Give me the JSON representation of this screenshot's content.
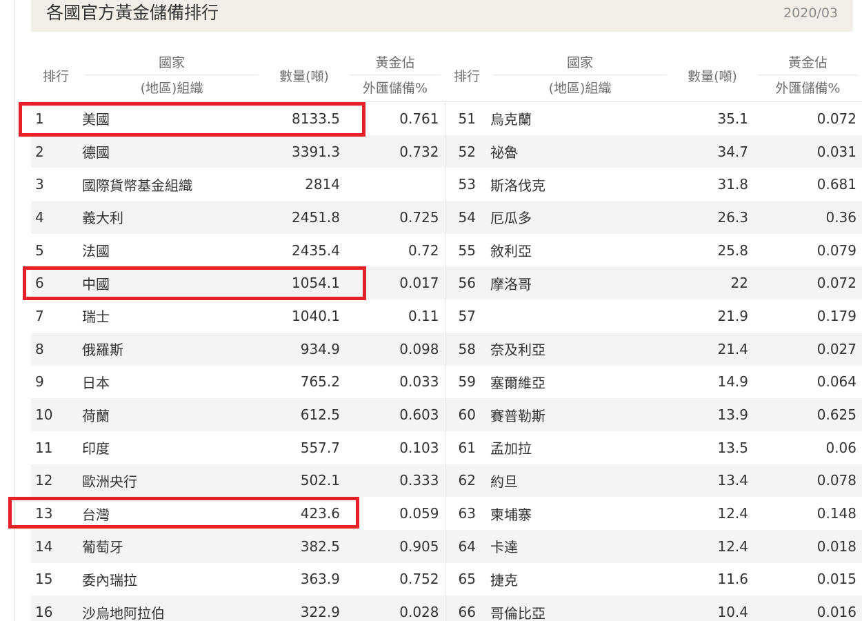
{
  "header": {
    "title": "各國官方黃金儲備排行",
    "date": "2020/03"
  },
  "columns": {
    "rank": "排行",
    "country_line1": "國家",
    "country_line2": "(地區)組織",
    "quantity": "數量(噸)",
    "percent_line1": "黃金佔",
    "percent_line2": "外匯儲備%"
  },
  "rows": [
    {
      "l": {
        "rank": "1",
        "country": "美國",
        "qty": "8133.5",
        "pct": "0.761"
      },
      "r": {
        "rank": "51",
        "country": "烏克蘭",
        "qty": "35.1",
        "pct": "0.072"
      }
    },
    {
      "l": {
        "rank": "2",
        "country": "德國",
        "qty": "3391.3",
        "pct": "0.732"
      },
      "r": {
        "rank": "52",
        "country": "祕魯",
        "qty": "34.7",
        "pct": "0.031"
      }
    },
    {
      "l": {
        "rank": "3",
        "country": "國際貨幣基金組織",
        "qty": "2814",
        "pct": ""
      },
      "r": {
        "rank": "53",
        "country": "斯洛伐克",
        "qty": "31.8",
        "pct": "0.681"
      }
    },
    {
      "l": {
        "rank": "4",
        "country": "義大利",
        "qty": "2451.8",
        "pct": "0.725"
      },
      "r": {
        "rank": "54",
        "country": "厄瓜多",
        "qty": "26.3",
        "pct": "0.36"
      }
    },
    {
      "l": {
        "rank": "5",
        "country": "法國",
        "qty": "2435.4",
        "pct": "0.72"
      },
      "r": {
        "rank": "55",
        "country": "敘利亞",
        "qty": "25.8",
        "pct": "0.079"
      }
    },
    {
      "l": {
        "rank": "6",
        "country": "中國",
        "qty": "1054.1",
        "pct": "0.017"
      },
      "r": {
        "rank": "56",
        "country": "摩洛哥",
        "qty": "22",
        "pct": "0.072"
      }
    },
    {
      "l": {
        "rank": "7",
        "country": "瑞士",
        "qty": "1040.1",
        "pct": "0.11"
      },
      "r": {
        "rank": "57",
        "country": "",
        "qty": "21.9",
        "pct": "0.179"
      }
    },
    {
      "l": {
        "rank": "8",
        "country": "俄羅斯",
        "qty": "934.9",
        "pct": "0.098"
      },
      "r": {
        "rank": "58",
        "country": "奈及利亞",
        "qty": "21.4",
        "pct": "0.027"
      }
    },
    {
      "l": {
        "rank": "9",
        "country": "日本",
        "qty": "765.2",
        "pct": "0.033"
      },
      "r": {
        "rank": "59",
        "country": "塞爾維亞",
        "qty": "14.9",
        "pct": "0.064"
      }
    },
    {
      "l": {
        "rank": "10",
        "country": "荷蘭",
        "qty": "612.5",
        "pct": "0.603"
      },
      "r": {
        "rank": "60",
        "country": "賽普勒斯",
        "qty": "13.9",
        "pct": "0.625"
      }
    },
    {
      "l": {
        "rank": "11",
        "country": "印度",
        "qty": "557.7",
        "pct": "0.103"
      },
      "r": {
        "rank": "61",
        "country": "孟加拉",
        "qty": "13.5",
        "pct": "0.06"
      }
    },
    {
      "l": {
        "rank": "12",
        "country": "歐洲央行",
        "qty": "502.1",
        "pct": "0.333"
      },
      "r": {
        "rank": "62",
        "country": "約旦",
        "qty": "13.4",
        "pct": "0.078"
      }
    },
    {
      "l": {
        "rank": "13",
        "country": "台灣",
        "qty": "423.6",
        "pct": "0.059"
      },
      "r": {
        "rank": "63",
        "country": "柬埔寨",
        "qty": "12.4",
        "pct": "0.148"
      }
    },
    {
      "l": {
        "rank": "14",
        "country": "葡萄牙",
        "qty": "382.5",
        "pct": "0.905"
      },
      "r": {
        "rank": "64",
        "country": "卡達",
        "qty": "12.4",
        "pct": "0.018"
      }
    },
    {
      "l": {
        "rank": "15",
        "country": "委內瑞拉",
        "qty": "363.9",
        "pct": "0.752"
      },
      "r": {
        "rank": "65",
        "country": "捷克",
        "qty": "11.6",
        "pct": "0.015"
      }
    },
    {
      "l": {
        "rank": "16",
        "country": "沙烏地阿拉伯",
        "qty": "322.9",
        "pct": "0.028"
      },
      "r": {
        "rank": "66",
        "country": "哥倫比亞",
        "qty": "10.4",
        "pct": "0.016"
      }
    }
  ],
  "highlight_color": "#e52029"
}
